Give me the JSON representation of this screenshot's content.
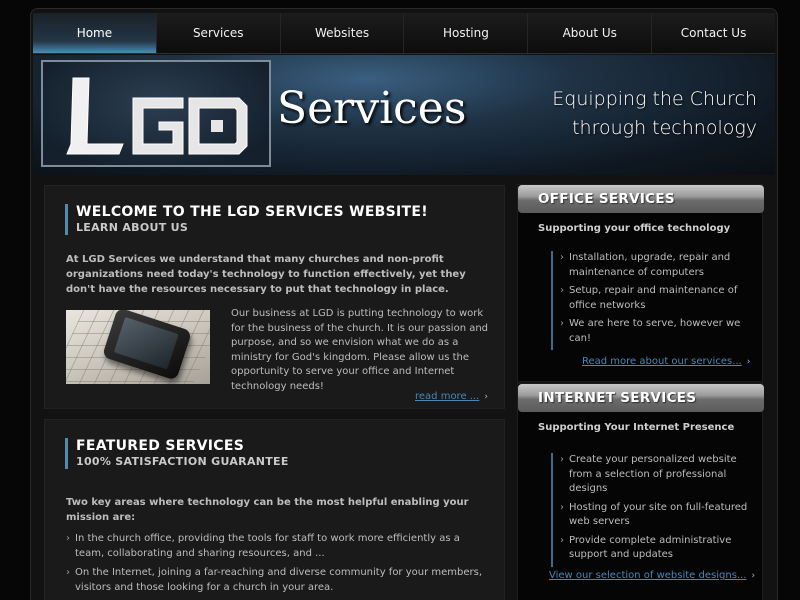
{
  "nav": {
    "items": [
      {
        "label": "Home",
        "active": true
      },
      {
        "label": "Services"
      },
      {
        "label": "Websites"
      },
      {
        "label": "Hosting"
      },
      {
        "label": "About Us"
      },
      {
        "label": "Contact Us"
      }
    ]
  },
  "header": {
    "logo_text": "LGD",
    "services_word": "Services",
    "tagline_line1": "Equipping the Church",
    "tagline_line2": "through technology"
  },
  "welcome": {
    "title": "WELCOME TO THE LGD SERVICES WEBSITE!",
    "subtitle": "LEARN ABOUT US",
    "intro": "At LGD Services we understand that many churches and non-profit organizations need today's technology to function effectively, yet they don't have the resources necessary to put that technology in place.",
    "body": "Our business at LGD is putting technology to work for the business of the church. It is our passion and purpose, and so we envision what we do as a ministry for God's kingdom. Please allow us the opportunity to serve your office and Internet technology needs!",
    "read_more": "read more ..."
  },
  "featured": {
    "title": "FEATURED SERVICES",
    "subtitle": "100% SATISFACTION GUARANTEE",
    "intro": "Two key areas where technology can be the most helpful enabling your mission are:",
    "bullets": [
      "In the church office, providing the tools for staff to work more efficiently as a team, collaborating and sharing resources, and ...",
      "On the Internet, joining a far-reaching and diverse community for your members, visitors and those looking for a church in your area."
    ]
  },
  "office": {
    "title": "OFFICE SERVICES",
    "subtitle": "Supporting your office technology",
    "items": [
      "Installation, upgrade, repair and maintenance of computers",
      "Setup, repair and maintenance of office networks",
      "We are here to serve, however we can!"
    ],
    "link": "Read more about our services..."
  },
  "internet": {
    "title": "INTERNET SERVICES",
    "subtitle": "Supporting Your Internet Presence",
    "items": [
      "Create your personalized website from a selection of professional designs",
      "Hosting of your site on full-featured web servers",
      "Provide complete administrative support and updates"
    ],
    "link": "View our selection of website designs..."
  },
  "colors": {
    "accent": "#4a8db5",
    "link": "#4a86b6",
    "background": "#060606"
  }
}
